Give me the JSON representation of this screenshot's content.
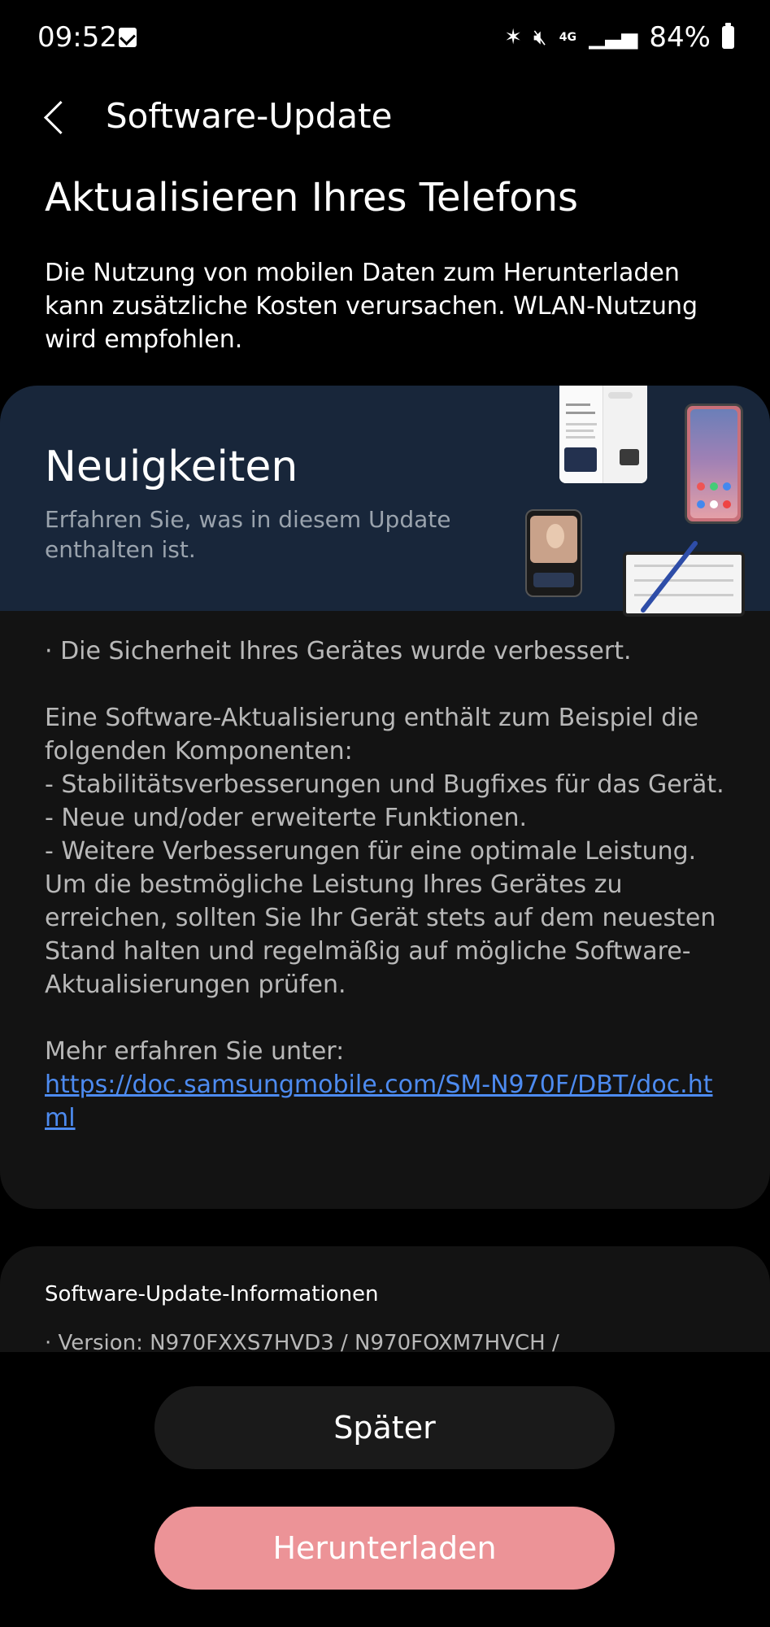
{
  "status_bar": {
    "time": "09:52",
    "battery": "84%",
    "network": "4G",
    "icons": [
      "checkbox-notification-icon",
      "bluetooth-icon",
      "mute-icon",
      "4g-icon",
      "signal-icon",
      "battery-icon"
    ]
  },
  "header": {
    "title": "Software-Update"
  },
  "page": {
    "heading": "Aktualisieren Ihres Telefons",
    "intro": "Die Nutzung von mobilen Daten zum Herunterladen kann zusätzliche Kosten verursachen. WLAN-Nutzung wird empfohlen."
  },
  "news": {
    "title": "Neuigkeiten",
    "subtitle": "Erfahren Sie, was in diesem Update enthalten ist.",
    "security_line": "· Die Sicherheit Ihres Gerätes wurde verbessert.",
    "components_intro": "Eine Software-Aktualisierung enthält zum Beispiel die folgenden Komponenten:",
    "item_1": " - Stabilitätsverbesserungen und Bugfixes für das Gerät.",
    "item_2": " - Neue und/oder erweiterte Funktionen.",
    "item_3": " - Weitere Verbesserungen für eine optimale Leistung.",
    "advice": "Um die bestmögliche Leistung Ihres Gerätes zu erreichen, sollten Sie Ihr Gerät stets auf dem neuesten Stand halten und regelmäßig auf mögliche Software-Aktualisierungen prüfen.",
    "more_label": "Mehr erfahren Sie unter:",
    "link": "https://doc.samsungmobile.com/SM-N970F/DBT/doc.html"
  },
  "info": {
    "title": "Software-Update-Informationen",
    "version": "· Version: N970FXXS7HVD3 / N970FOXM7HVCH /"
  },
  "buttons": {
    "later": "Später",
    "download": "Herunterladen"
  }
}
